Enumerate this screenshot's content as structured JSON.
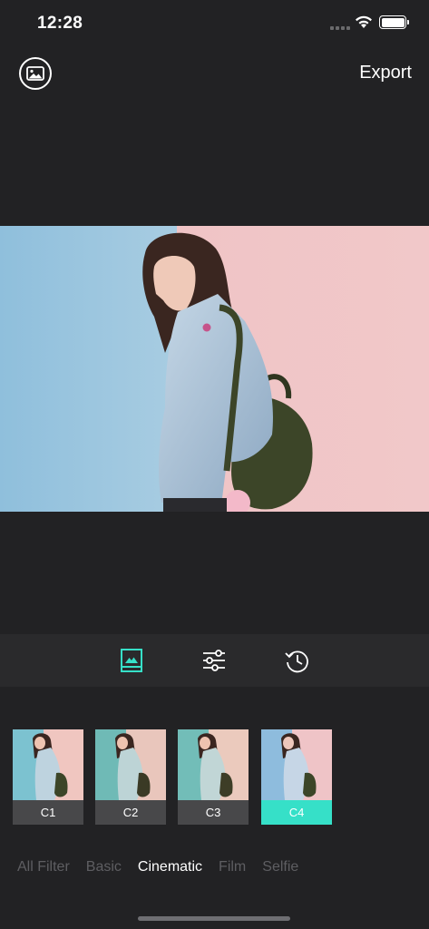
{
  "status_bar": {
    "time": "12:28",
    "icons": [
      "signal-icon",
      "wifi-icon",
      "battery-icon"
    ]
  },
  "nav": {
    "gallery_icon": "gallery-icon",
    "export_label": "Export"
  },
  "toolbar": {
    "tools": [
      "filter-icon",
      "adjust-sliders-icon",
      "history-icon"
    ],
    "active_tool": "filter-icon"
  },
  "filters": [
    {
      "label": "C1",
      "active": false
    },
    {
      "label": "C2",
      "active": false
    },
    {
      "label": "C3",
      "active": false
    },
    {
      "label": "C4",
      "active": true
    }
  ],
  "categories": [
    {
      "label": "All Filter",
      "active": false
    },
    {
      "label": "Basic",
      "active": false
    },
    {
      "label": "Cinematic",
      "active": true
    },
    {
      "label": "Film",
      "active": false
    },
    {
      "label": "Selfie",
      "active": false
    }
  ],
  "colors": {
    "accent": "#36e0c8",
    "background": "#222224",
    "toolbar": "#2a2a2c",
    "inactive_text": "#5e5e62"
  }
}
